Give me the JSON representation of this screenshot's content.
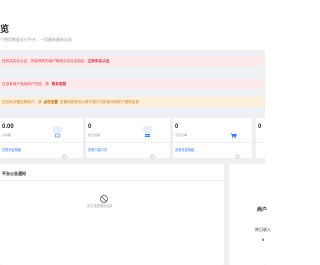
{
  "header": {
    "title": "览",
    "subtitle": "个使用数据支付平台，一切最新最新动态"
  },
  "alerts": {
    "verify": {
      "text": "还完成实名认证，所能得到的商户都将无法实名验证",
      "action": "立即实名认证"
    },
    "notice": {
      "text": "还没有商户使用商户完成，请",
      "action": "联系客服"
    },
    "settlement": {
      "text": "还没有设置结算账户，请",
      "action": "点击设置",
      "suffix": "设置收款账号以便于接口付款使用到账户提现信息"
    }
  },
  "stats": [
    {
      "value": "0.00",
      "label": "户余额",
      "link": "查看资金明细",
      "icon": "wallet-icon"
    },
    {
      "value": "0",
      "label": "接口代码",
      "link": "查看口接口详",
      "icon": "card-icon"
    },
    {
      "value": "0",
      "label": "今日订单",
      "link": "查看资金明细",
      "icon": "cart-icon"
    },
    {
      "value": "0",
      "label": "",
      "link": "",
      "icon": ""
    }
  ],
  "announcements": {
    "title": "平台公告通知",
    "empty_text": "暂无该数据该信息"
  },
  "side_panel": {
    "line1": "商户",
    "line2": "昨日收入",
    "line3": "0"
  },
  "colors": {
    "accent": "#3a7cf5",
    "danger": "#d8454f",
    "warning": "#c9852e",
    "background": "#eef0f4"
  }
}
